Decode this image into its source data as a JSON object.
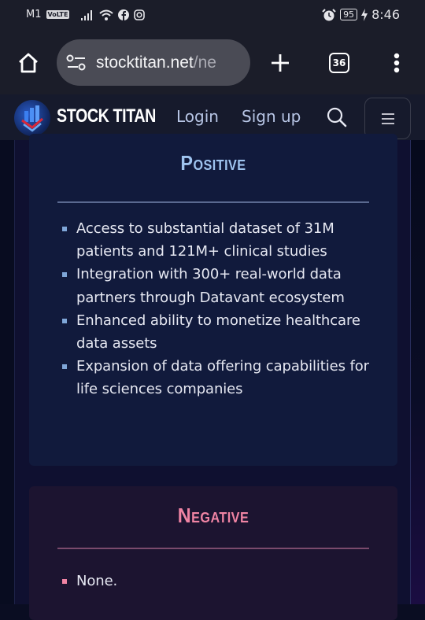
{
  "status_bar": {
    "carrier": "M1",
    "volte": "VoLTE",
    "battery": "95",
    "time": "8:46",
    "icons": [
      "signal-icon",
      "wifi-icon",
      "facebook-icon",
      "instagram-icon",
      "alarm-icon",
      "battery-icon",
      "charging-icon"
    ]
  },
  "browser": {
    "url_domain": "stocktitan.net",
    "url_path": "/ne",
    "tabs_count": "36"
  },
  "site_header": {
    "brand": "STOCK TITAN",
    "login": "Login",
    "signup": "Sign up"
  },
  "positive": {
    "title": "Positive",
    "color": "#9fc4ef",
    "items": [
      "Access to substantial dataset of 31M patients and 121M+ clinical studies",
      "Integration with 300+ real-world data partners through Datavant ecosystem",
      "Enhanced ability to monetize healthcare data assets",
      "Expansion of data offering capabilities for life sciences companies"
    ]
  },
  "negative": {
    "title": "Negative",
    "color": "#f084a4",
    "items": [
      "None."
    ]
  }
}
